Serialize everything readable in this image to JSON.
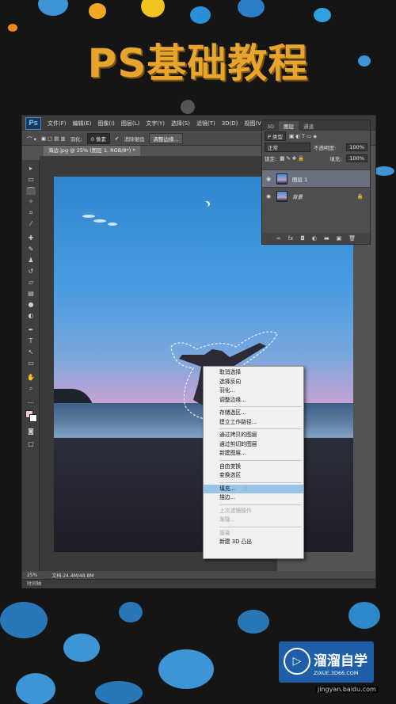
{
  "title": "PS基础教程",
  "menu": [
    "文件(F)",
    "编辑(E)",
    "图像(I)",
    "图层(L)",
    "文字(Y)",
    "选择(S)",
    "滤镜(T)",
    "3D(D)",
    "视图(V)"
  ],
  "options": {
    "feather_label": "羽化:",
    "feather_value": "0 像素",
    "antialias_label": "消除锯齿",
    "refine_edge": "调整边缘..."
  },
  "document_tab": "海边.jpg @ 25% (图层 1, RGB/8*) *",
  "layers_panel": {
    "tabs": [
      "3D",
      "图层",
      "通道"
    ],
    "kind_filter": "P 类型",
    "blend_mode": "正常",
    "opacity_label": "不透明度:",
    "opacity_value": "100%",
    "lock_label": "锁定:",
    "fill_label": "填充:",
    "fill_value": "100%",
    "layers": [
      {
        "name": "图层 1"
      },
      {
        "name": "背景"
      }
    ]
  },
  "context_menu": {
    "items": [
      {
        "label": "取消选择",
        "disabled": false
      },
      {
        "label": "选择反向",
        "disabled": false
      },
      {
        "label": "羽化...",
        "disabled": false
      },
      {
        "label": "调整边缘...",
        "disabled": false
      },
      {
        "sep": true
      },
      {
        "label": "存储选区...",
        "disabled": false
      },
      {
        "label": "建立工作路径...",
        "disabled": false
      },
      {
        "sep": true
      },
      {
        "label": "通过拷贝的图层",
        "disabled": false
      },
      {
        "label": "通过剪切的图层",
        "disabled": false
      },
      {
        "label": "新建图层...",
        "disabled": false
      },
      {
        "sep": true
      },
      {
        "label": "自由变换",
        "disabled": false
      },
      {
        "label": "变换选区",
        "disabled": false
      },
      {
        "sep": true
      },
      {
        "label": "填充...",
        "disabled": false,
        "selected": true
      },
      {
        "label": "描边...",
        "disabled": false
      },
      {
        "sep": true
      },
      {
        "label": "上次滤镜操作",
        "disabled": true
      },
      {
        "label": "渐隐...",
        "disabled": true
      },
      {
        "sep": true
      },
      {
        "label": "渲染",
        "disabled": true
      },
      {
        "label": "新建 3D 凸出",
        "disabled": false
      }
    ]
  },
  "status": {
    "zoom": "25%",
    "doc": "文档:24.4M/48.8M"
  },
  "timeline_label": "时间轴",
  "watermark": {
    "title": "溜溜自学",
    "site": "ZIXUE.3D66.COM"
  },
  "credit": "jingyan.baidu.com",
  "colors": {
    "title": "#e8a52e",
    "accent_blue": "#3d95d6",
    "menu_highlight": "#99c4ea"
  }
}
